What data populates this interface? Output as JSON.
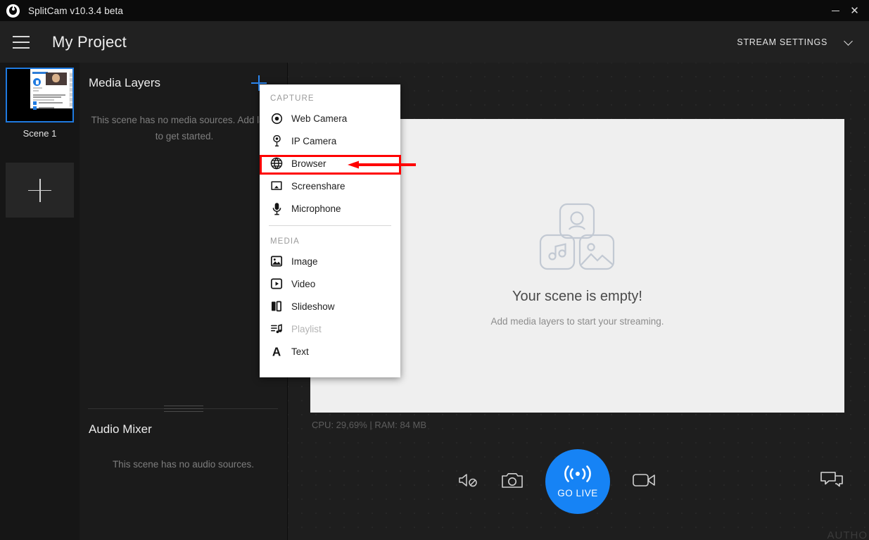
{
  "titlebar": {
    "app_title": "SplitCam v10.3.4 beta",
    "logo_icon": "splitcam-logo-icon",
    "minimize_label": "–",
    "close_label": "✕"
  },
  "header": {
    "menu_icon": "hamburger-menu-icon",
    "project_title": "My Project",
    "stream_settings_label": "STREAM SETTINGS",
    "chevron_icon": "chevron-down-icon"
  },
  "scenes": {
    "items": [
      {
        "label": "Scene 1",
        "selected": true
      }
    ],
    "add_scene_icon": "plus-icon"
  },
  "layers_panel": {
    "title": "Media Layers",
    "add_icon": "plus-icon",
    "empty_text": "This scene has no media sources. Add layer to get started.",
    "audio_title": "Audio Mixer",
    "audio_empty_text": "This scene has no audio sources."
  },
  "add_layer_menu": {
    "sections": [
      {
        "label": "CAPTURE",
        "items": [
          {
            "label": "Web Camera",
            "icon": "web-camera-icon",
            "disabled": false
          },
          {
            "label": "IP Camera",
            "icon": "ip-camera-icon",
            "disabled": false
          },
          {
            "label": "Browser",
            "icon": "globe-browser-icon",
            "disabled": false,
            "highlighted": true
          },
          {
            "label": "Screenshare",
            "icon": "screenshare-icon",
            "disabled": false
          },
          {
            "label": "Microphone",
            "icon": "microphone-icon",
            "disabled": false
          }
        ]
      },
      {
        "label": "MEDIA",
        "items": [
          {
            "label": "Image",
            "icon": "image-icon",
            "disabled": false
          },
          {
            "label": "Video",
            "icon": "video-icon",
            "disabled": false
          },
          {
            "label": "Slideshow",
            "icon": "slideshow-icon",
            "disabled": false
          },
          {
            "label": "Playlist",
            "icon": "playlist-icon",
            "disabled": true
          },
          {
            "label": "Text",
            "icon": "text-icon",
            "disabled": false
          }
        ]
      }
    ]
  },
  "preview": {
    "brightness_icon": "brightness-sun-icon",
    "empty_icon": "media-layers-placeholder-icon",
    "empty_title": "Your scene is empty!",
    "empty_subtitle": "Add media layers to start your streaming.",
    "stats_text": "CPU: 29,69% | RAM: 84 MB"
  },
  "bottom_toolbar": {
    "mute_icon": "speaker-mute-icon",
    "snapshot_icon": "camera-snapshot-icon",
    "record_icon": "video-record-icon",
    "chat_icon": "chat-bubbles-icon",
    "go_live_label": "GO LIVE",
    "go_live_icon": "broadcast-signal-icon",
    "go_live_color": "#1683f5"
  },
  "annotation": {
    "highlight_color": "#ff0000",
    "target": "Browser"
  },
  "watermark": {
    "text": "AUTHO"
  }
}
